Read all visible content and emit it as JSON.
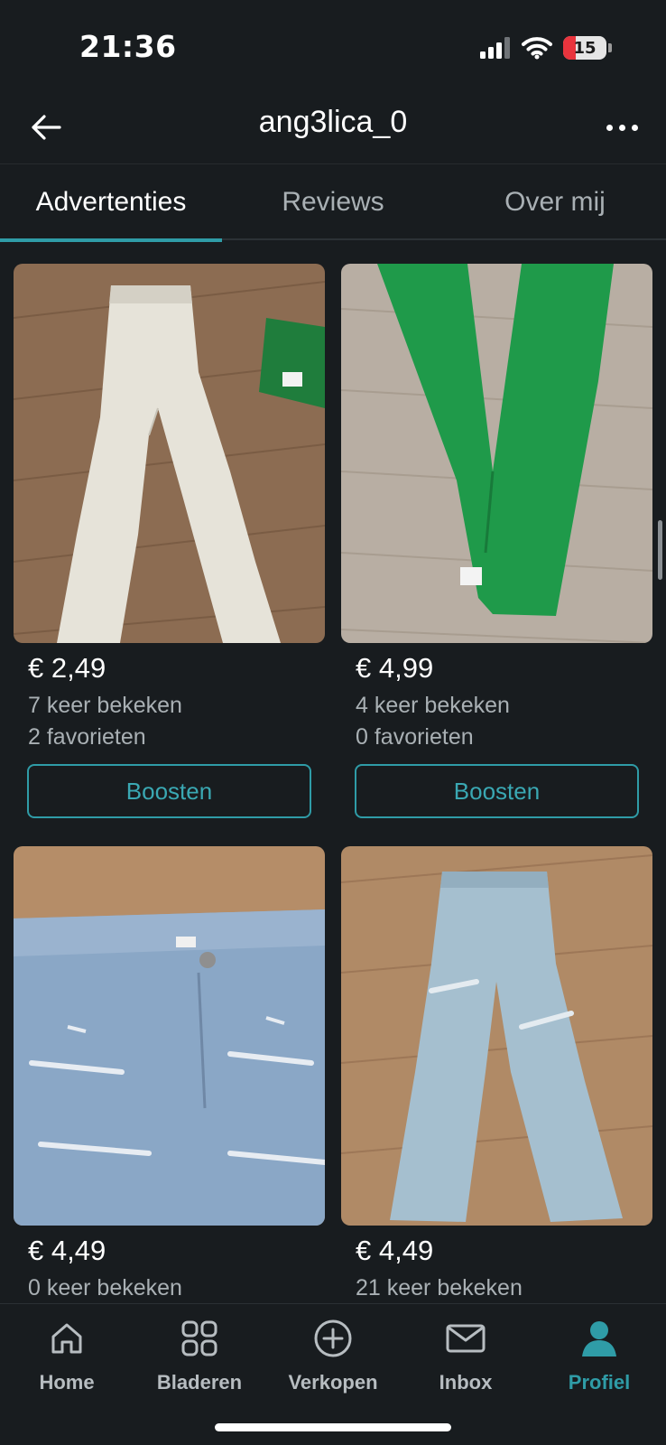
{
  "status_bar": {
    "time": "21:36",
    "battery_level": "15"
  },
  "header": {
    "title": "ang3lica_0"
  },
  "tabs": [
    {
      "label": "Advertenties",
      "active": true
    },
    {
      "label": "Reviews",
      "active": false
    },
    {
      "label": "Over mij",
      "active": false
    }
  ],
  "listings": [
    {
      "price": "€ 2,49",
      "views": "7 keer bekeken",
      "favorites": "2 favorieten",
      "button_label": "Boosten"
    },
    {
      "price": "€ 4,99",
      "views": "4 keer bekeken",
      "favorites": "0 favorieten",
      "button_label": "Boosten"
    },
    {
      "price": "€ 4,49",
      "views": "0 keer bekeken"
    },
    {
      "price": "€ 4,49",
      "views": "21 keer bekeken"
    }
  ],
  "bottom_nav": [
    {
      "label": "Home",
      "icon": "home-icon",
      "active": false
    },
    {
      "label": "Bladeren",
      "icon": "grid-icon",
      "active": false
    },
    {
      "label": "Verkopen",
      "icon": "plus-circle-icon",
      "active": false
    },
    {
      "label": "Inbox",
      "icon": "envelope-icon",
      "active": false
    },
    {
      "label": "Profiel",
      "icon": "person-icon",
      "active": true
    }
  ],
  "colors": {
    "background": "#181c1f",
    "accent": "#2f9ca7",
    "muted_text": "#a9b0b4"
  }
}
